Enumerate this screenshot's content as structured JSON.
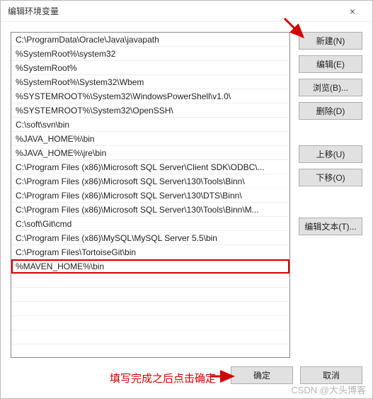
{
  "dialog": {
    "title": "编辑环境变量",
    "close": "×"
  },
  "paths": [
    "C:\\ProgramData\\Oracle\\Java\\javapath",
    "%SystemRoot%\\system32",
    "%SystemRoot%",
    "%SystemRoot%\\System32\\Wbem",
    "%SYSTEMROOT%\\System32\\WindowsPowerShell\\v1.0\\",
    "%SYSTEMROOT%\\System32\\OpenSSH\\",
    "C:\\soft\\svn\\bin",
    "%JAVA_HOME%\\bin",
    "%JAVA_HOME%\\jre\\bin",
    "C:\\Program Files (x86)\\Microsoft SQL Server\\Client SDK\\ODBC\\...",
    "C:\\Program Files (x86)\\Microsoft SQL Server\\130\\Tools\\Binn\\",
    "C:\\Program Files (x86)\\Microsoft SQL Server\\130\\DTS\\Binn\\",
    "C:\\Program Files (x86)\\Microsoft SQL Server\\130\\Tools\\Binn\\M...",
    "C:\\soft\\Git\\cmd",
    "C:\\Program Files (x86)\\MySQL\\MySQL Server 5.5\\bin",
    "C:\\Program Files\\TortoiseGit\\bin",
    "%MAVEN_HOME%\\bin"
  ],
  "highlight_index": 16,
  "buttons": {
    "new": "新建(N)",
    "edit": "编辑(E)",
    "browse": "浏览(B)...",
    "delete": "删除(D)",
    "moveUp": "上移(U)",
    "moveDown": "下移(O)",
    "editText": "编辑文本(T)...",
    "ok": "确定",
    "cancel": "取消"
  },
  "annotations": {
    "footer_note": "填写完成之后点击确定",
    "arrow_color": "#d40000"
  },
  "watermark": "CSDN @大头博客"
}
